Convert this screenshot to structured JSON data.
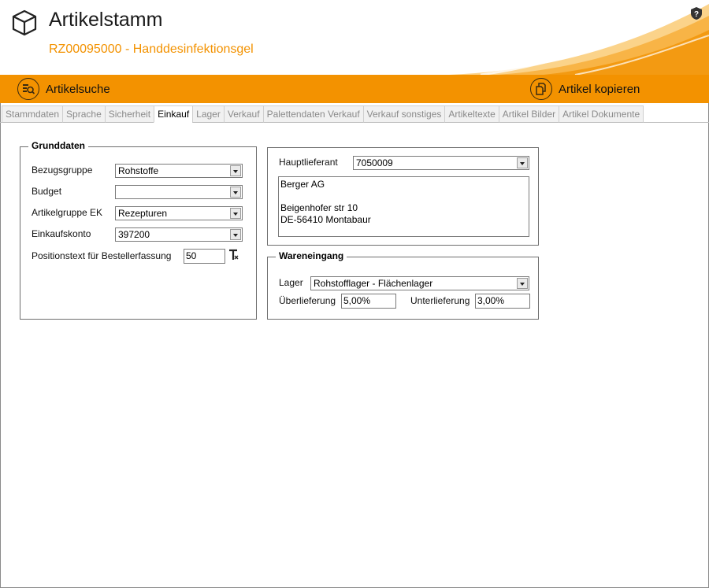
{
  "header": {
    "title": "Artikelstamm",
    "subtitle": "RZ00095000 - Handdesinfektionsgel",
    "app_icon": "box-icon",
    "help_icon": "shield-help-icon"
  },
  "toolbar": {
    "search_label": "Artikelsuche",
    "copy_label": "Artikel kopieren",
    "accent_color": "#f39200"
  },
  "tabs": [
    {
      "label": "Stammdaten",
      "active": false
    },
    {
      "label": "Sprache",
      "active": false
    },
    {
      "label": "Sicherheit",
      "active": false
    },
    {
      "label": "Einkauf",
      "active": true
    },
    {
      "label": "Lager",
      "active": false
    },
    {
      "label": "Verkauf",
      "active": false
    },
    {
      "label": "Palettendaten Verkauf",
      "active": false
    },
    {
      "label": "Verkauf sonstiges",
      "active": false
    },
    {
      "label": "Artikeltexte",
      "active": false
    },
    {
      "label": "Artikel Bilder",
      "active": false
    },
    {
      "label": "Artikel Dokumente",
      "active": false
    }
  ],
  "grunddaten": {
    "legend": "Grunddaten",
    "bezugsgruppe_label": "Bezugsgruppe",
    "bezugsgruppe_value": "Rohstoffe",
    "budget_label": "Budget",
    "budget_value": "",
    "artikelgruppe_label": "Artikelgruppe EK",
    "artikelgruppe_value": "Rezepturen",
    "einkaufskonto_label": "Einkaufskonto",
    "einkaufskonto_value": "397200",
    "positionstext_label": "Positionstext für Bestellerfassung",
    "positionstext_value": "50"
  },
  "lieferant": {
    "hauptlieferant_label": "Hauptlieferant",
    "hauptlieferant_value": "7050009",
    "address": "Berger AG\n\nBeigenhofer str 10\nDE-56410 Montabaur"
  },
  "wareneingang": {
    "legend": "Wareneingang",
    "lager_label": "Lager",
    "lager_value": "Rohstofflager - Flächenlager",
    "ueberlieferung_label": "Überlieferung",
    "ueberlieferung_value": "5,00%",
    "unterlieferung_label": "Unterlieferung",
    "unterlieferung_value": "3,00%"
  }
}
